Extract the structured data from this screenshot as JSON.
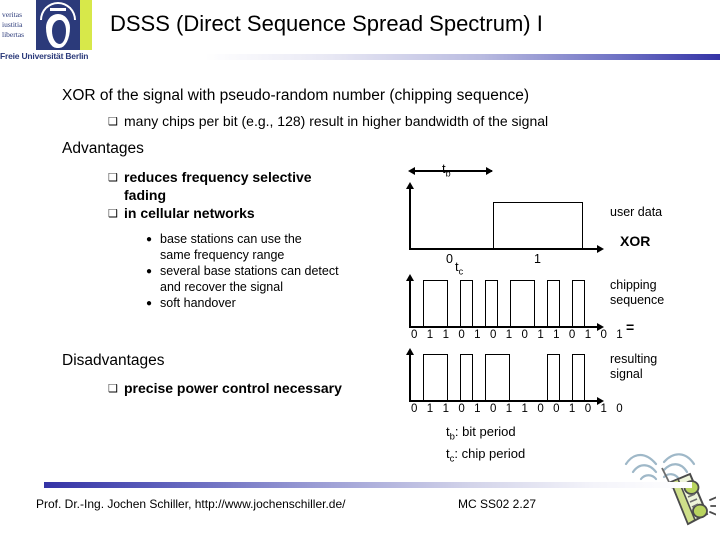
{
  "logo": {
    "motto_lines": [
      "veritas",
      "iustitia",
      "libertas"
    ],
    "university": "Freie Universität Berlin",
    "seal_color": "#2b3a7a",
    "stripe_color": "#d7e84a"
  },
  "header": {
    "title": "DSSS (Direct Sequence Spread Spectrum) I",
    "rule_accent": "#3433a6"
  },
  "body": {
    "line1": "XOR of the signal with pseudo-random number (chipping sequence)",
    "line1_sub": {
      "bullet": "❑",
      "text": "many chips per bit (e.g., 128) result in higher bandwidth of the signal"
    },
    "advantages_heading": "Advantages",
    "advantages": [
      {
        "bullet": "❑",
        "text": "reduces frequency selective fading"
      },
      {
        "bullet": "❑",
        "text": "in cellular networks"
      }
    ],
    "advantages_sub": [
      {
        "bullet": "●",
        "text": "base stations can use the same frequency range"
      },
      {
        "bullet": "●",
        "text": "several base stations can detect and recover the signal"
      },
      {
        "bullet": "●",
        "text": "soft handover"
      }
    ],
    "disadvantages_heading": "Disadvantages",
    "disadvantages": [
      {
        "bullet": "❑",
        "text": "precise power control necessary"
      }
    ]
  },
  "diagram": {
    "tb_label": "tb",
    "tc_label": "tc",
    "user_data": {
      "name": "user data",
      "tick_labels": [
        "0",
        "1"
      ],
      "bits": [
        0,
        1
      ]
    },
    "operator_xor": "XOR",
    "chipping": {
      "name_line1": "chipping",
      "name_line2": "sequence",
      "bits": [
        0,
        1,
        1,
        0,
        1,
        0,
        1,
        0,
        1,
        1,
        0,
        1,
        0,
        1
      ],
      "bit_string": "0 1 1 0 1 0 1 0 1 1 0 1 0 1"
    },
    "operator_equals": "=",
    "resulting": {
      "name_line1": "resulting",
      "name_line2": "signal",
      "bits": [
        0,
        1,
        1,
        0,
        1,
        0,
        1,
        1,
        0,
        0,
        1,
        0,
        1,
        0
      ],
      "bit_string": "0 1 1 0 1 0 1 1 0 0 1 0 1 0"
    }
  },
  "legend": {
    "tb": "tb: bit period",
    "tc": "tc: chip period"
  },
  "footer": {
    "left": "Prof. Dr.-Ing. Jochen Schiller, http://www.jochenschiller.de/",
    "right": "MC SS02   2.27"
  }
}
